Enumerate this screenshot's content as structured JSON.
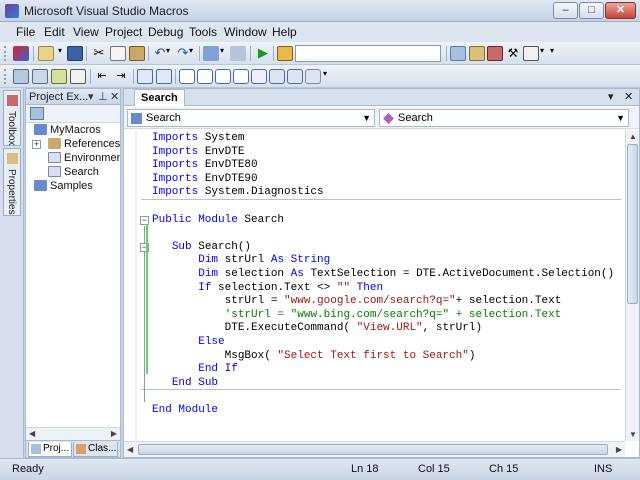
{
  "window": {
    "title": "Microsoft Visual Studio Macros"
  },
  "titlebar_buttons": [
    "–",
    "□",
    "✕"
  ],
  "menu": [
    "File",
    "Edit",
    "View",
    "Project",
    "Debug",
    "Tools",
    "Window",
    "Help"
  ],
  "toolbar1": {
    "icons": [
      "view-vs-icon",
      "add-item-icon",
      "save-icon",
      "cut-icon",
      "copy-icon",
      "paste-icon",
      "undo-icon",
      "redo-icon",
      "nav-back-icon",
      "nav-forward-icon",
      "run-icon",
      "find-icon",
      "solution-explorer-icon",
      "properties-icon",
      "toolbox-icon",
      "tools-icon",
      "command-window-icon"
    ],
    "find_value": ""
  },
  "toolbar2": {
    "icons": [
      "list-members-icon",
      "param-info-icon",
      "quick-info-icon",
      "complete-word-icon",
      "outdent-icon",
      "indent-icon",
      "comment-icon",
      "uncomment-icon",
      "bookmark-icon",
      "prev-bookmark-icon",
      "next-bookmark-icon",
      "prev-folder-bookmark-icon",
      "next-folder-bookmark-icon",
      "clear-bookmarks-icon"
    ]
  },
  "sidetabs": {
    "toolbox": "Toolbox",
    "properties": "Properties"
  },
  "project_explorer": {
    "title": "Project Ex...",
    "pin": "⊥",
    "close": "✕",
    "tree": [
      {
        "label": "MyMacros"
      },
      {
        "label": "References",
        "expander": "+"
      },
      {
        "label": "EnvironmentEvents"
      },
      {
        "label": "Search"
      },
      {
        "label": "Samples"
      }
    ],
    "tabs": [
      "Proj...",
      "Clas..."
    ]
  },
  "editor": {
    "tab_label": "Search",
    "tab_controls": [
      "▾",
      "✕"
    ],
    "nav_left": "Search",
    "nav_right": "Search",
    "status": {
      "ready": "Ready",
      "ln": "Ln 18",
      "col": "Col 15",
      "ch": "Ch 15",
      "ins": "INS"
    }
  },
  "code": [
    [
      [
        "kw",
        "Imports"
      ],
      [
        "",
        "System"
      ]
    ],
    [
      [
        "kw",
        "Imports"
      ],
      [
        "",
        "EnvDTE"
      ]
    ],
    [
      [
        "kw",
        "Imports"
      ],
      [
        "",
        "EnvDTE80"
      ]
    ],
    [
      [
        "kw",
        "Imports"
      ],
      [
        "",
        "EnvDTE90"
      ]
    ],
    [
      [
        "kw",
        "Imports"
      ],
      [
        "",
        "System.Diagnostics"
      ]
    ],
    [],
    [
      [
        "kw",
        "Public Module"
      ],
      [
        "",
        "Search"
      ]
    ],
    [],
    [
      [
        "",
        "   "
      ],
      [
        "kw",
        "Sub"
      ],
      [
        "",
        "Search()"
      ]
    ],
    [
      [
        "",
        "       "
      ],
      [
        "kw",
        "Dim"
      ],
      [
        "",
        "strUrl "
      ],
      [
        "kw",
        "As String"
      ]
    ],
    [
      [
        "",
        "       "
      ],
      [
        "kw",
        "Dim"
      ],
      [
        "",
        "selection "
      ],
      [
        "kw",
        "As"
      ],
      [
        "",
        "TextSelection = DTE.ActiveDocument.Selection()"
      ]
    ],
    [
      [
        "",
        "       "
      ],
      [
        "kw",
        "If"
      ],
      [
        "",
        "selection.Text <> "
      ],
      [
        "str",
        "\"\""
      ],
      [
        "kw",
        " Then"
      ]
    ],
    [
      [
        "",
        "           strUrl = "
      ],
      [
        "str",
        "\"www.google.com/search?q=\""
      ],
      [
        "",
        ""
      ],
      [
        "",
        ""
      ],
      [
        "",
        "+ selection.Text"
      ]
    ],
    [
      [
        "",
        "           "
      ],
      [
        "cmt",
        "'strUrl = \"www.bing.com/search?q=\" + selection.Text"
      ]
    ],
    [
      [
        "",
        "           DTE.ExecuteCommand("
      ],
      [
        "str",
        "\"View.URL\""
      ],
      [
        "",
        ", strUrl)"
      ]
    ],
    [
      [
        "",
        "       "
      ],
      [
        "kw",
        "Else"
      ]
    ],
    [
      [
        "",
        "           MsgBox("
      ],
      [
        "str",
        "\"Select Text first to Search\""
      ],
      [
        "",
        ")"
      ]
    ],
    [
      [
        "",
        "       "
      ],
      [
        "kw",
        "End If"
      ]
    ],
    [
      [
        "",
        "   "
      ],
      [
        "kw",
        "End Sub"
      ]
    ],
    [],
    [
      [
        "kw",
        "End Module"
      ]
    ]
  ]
}
